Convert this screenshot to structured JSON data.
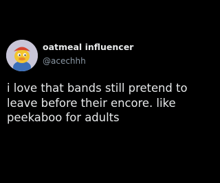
{
  "author": {
    "display_name": "oatmeal influencer",
    "handle": "@acechhh",
    "avatar_icon": "cartoon-character-avatar"
  },
  "tweet": {
    "text": "i love that bands still pretend to\nleave before their encore. like\npeekaboo for adults"
  },
  "colors": {
    "background": "#000000",
    "primary_text": "#e7e9ea",
    "secondary_text": "#8b98a5",
    "avatar_background": "#c9c6d8"
  }
}
